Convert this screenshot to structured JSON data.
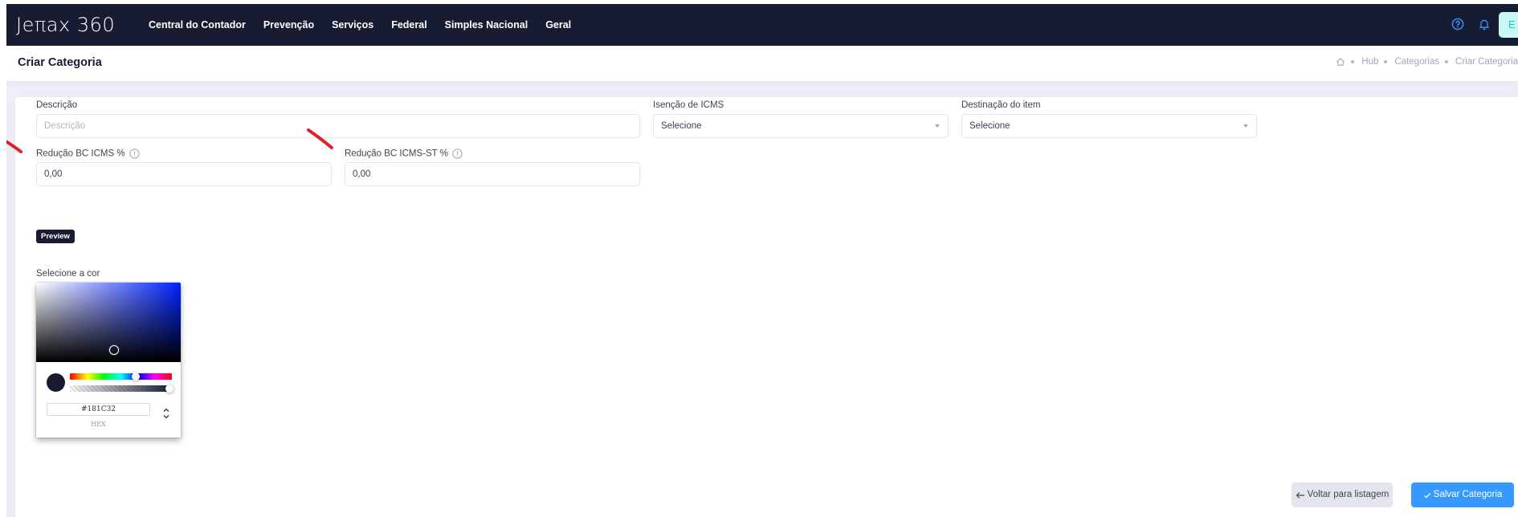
{
  "app": {
    "logo_text": "Jeπax 360"
  },
  "nav": {
    "items": [
      {
        "label": "Central do Contador"
      },
      {
        "label": "Prevenção"
      },
      {
        "label": "Serviços"
      },
      {
        "label": "Federal"
      },
      {
        "label": "Simples Nacional"
      },
      {
        "label": "Geral"
      }
    ],
    "user_initial": "E"
  },
  "page": {
    "title": "Criar Categoria",
    "breadcrumb": [
      "Hub",
      "Categorias",
      "Criar Categoria"
    ]
  },
  "form": {
    "descricao": {
      "label": "Descrição",
      "placeholder": "Descrição",
      "value": ""
    },
    "isencao_icms": {
      "label": "Isenção de ICMS",
      "selected": "Selecione"
    },
    "destinacao_item": {
      "label": "Destinação do item",
      "selected": "Selecione"
    },
    "reducao_bc_icms": {
      "label": "Redução BC ICMS %",
      "value": "0,00"
    },
    "reducao_bc_icms_st": {
      "label": "Redução BC ICMS-ST %",
      "value": "0,00"
    },
    "preview_badge": "Preview",
    "cor": {
      "label": "Selecione a cor",
      "hex_value": "#181C32",
      "hex_label": "HEX"
    }
  },
  "actions": {
    "back_label": "Voltar para listagem",
    "save_label": "Salvar Categoria"
  },
  "colors": {
    "navbar": "#181c32",
    "primary": "#3699ff",
    "selected_color": "#181c32",
    "annotation": "#e0202a"
  },
  "icons": [
    "home-icon",
    "help-icon",
    "bell-icon",
    "info-icon",
    "chevron-down-icon",
    "arrow-left-icon",
    "check-icon"
  ]
}
